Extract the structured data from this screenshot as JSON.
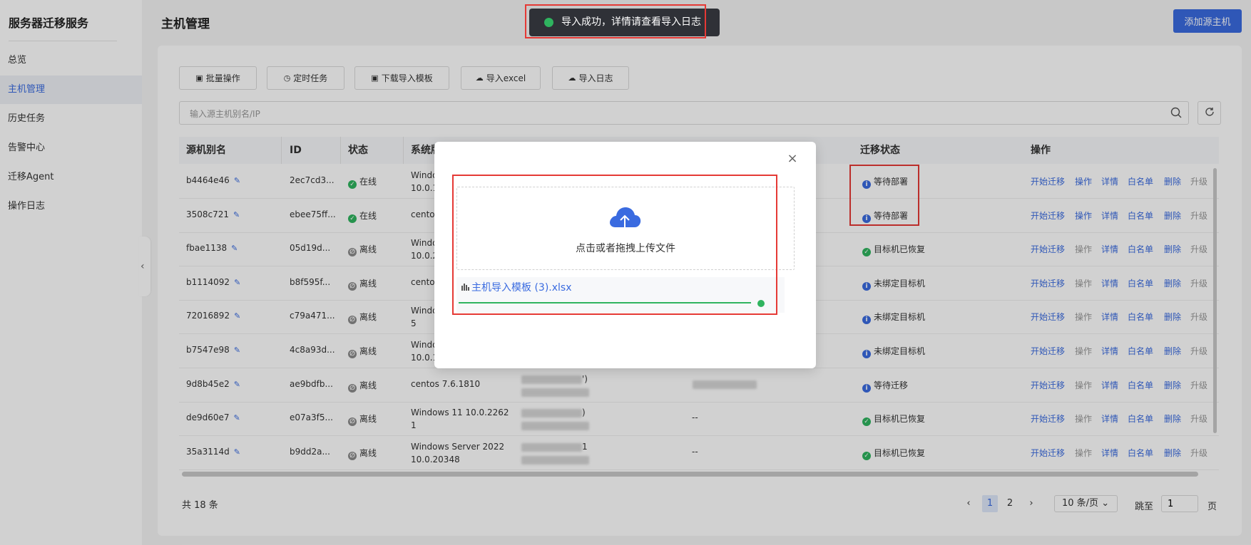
{
  "sidebar": {
    "title": "服务器迁移服务",
    "items": [
      {
        "label": "总览",
        "active": false
      },
      {
        "label": "主机管理",
        "active": true
      },
      {
        "label": "历史任务",
        "active": false
      },
      {
        "label": "告警中心",
        "active": false
      },
      {
        "label": "迁移Agent",
        "active": false
      },
      {
        "label": "操作日志",
        "active": false
      }
    ],
    "collapse_icon": "‹"
  },
  "header": {
    "title": "主机管理",
    "add_source_label": "添加源主机"
  },
  "toolbar": {
    "batch_label": "批量操作",
    "timed_label": "定时任务",
    "download_label": "下载导入模板",
    "import_excel_label": "导入excel",
    "import_log_label": "导入日志"
  },
  "search": {
    "placeholder": "输入源主机别名/IP"
  },
  "table": {
    "headers": {
      "alias": "源机别名",
      "id": "ID",
      "status": "状态",
      "os": "系统版",
      "migration": "迁移状态",
      "ops": "操作"
    },
    "op_labels": [
      "开始迁移",
      "操作",
      "详情",
      "白名单",
      "删除",
      "升级"
    ],
    "rows": [
      {
        "alias": "b4464e46",
        "id": "2ec7cd3...",
        "status": "在线",
        "online": true,
        "os1": "Windo",
        "os2": "10.0.1",
        "mig": "等待部署",
        "mig_ok": false,
        "ip": "",
        "target": ""
      },
      {
        "alias": "3508c721",
        "id": "ebee75ff...",
        "status": "在线",
        "online": true,
        "os1": "cento",
        "os2": "",
        "mig": "等待部署",
        "mig_ok": false,
        "ip": "",
        "target": ""
      },
      {
        "alias": "fbae1138",
        "id": "05d19d...",
        "status": "离线",
        "online": false,
        "os1": "Windo",
        "os2": "10.0.2",
        "mig": "目标机已恢复",
        "mig_ok": true,
        "ip": "",
        "target": ""
      },
      {
        "alias": "b1114092",
        "id": "b8f595f...",
        "status": "离线",
        "online": false,
        "os1": "cento",
        "os2": "",
        "mig": "未绑定目标机",
        "mig_ok": false,
        "ip": "",
        "target": ""
      },
      {
        "alias": "72016892",
        "id": "c79a471...",
        "status": "离线",
        "online": false,
        "os1": "Windo",
        "os2": "5",
        "mig": "未绑定目标机",
        "mig_ok": false,
        "ip": "",
        "target": ""
      },
      {
        "alias": "b7547e98",
        "id": "4c8a93d...",
        "status": "离线",
        "online": false,
        "os1": "Windo",
        "os2": "10.0.1",
        "mig": "未绑定目标机",
        "mig_ok": false,
        "ip": "",
        "target": ""
      },
      {
        "alias": "9d8b45e2",
        "id": "ae9bdfb...",
        "status": "离线",
        "online": false,
        "os1": "centos 7.6.1810",
        "os2": "",
        "mig": "等待迁移",
        "mig_ok": false,
        "ip": "')",
        "target": ""
      },
      {
        "alias": "de9d60e7",
        "id": "e07a3f5...",
        "status": "离线",
        "online": false,
        "os1": "Windows 11 10.0.2262",
        "os2": "1",
        "mig": "目标机已恢复",
        "mig_ok": true,
        "ip": ")",
        "target": "--"
      },
      {
        "alias": "35a3114d",
        "id": "b9dd2a...",
        "status": "离线",
        "online": false,
        "os1": "Windows Server 2022",
        "os2": "10.0.20348",
        "mig": "目标机已恢复",
        "mig_ok": true,
        "ip": "1",
        "target": "--"
      }
    ]
  },
  "footer": {
    "total": "共 18 条",
    "prev_icon": "‹",
    "next_icon": "›",
    "pages": [
      "1",
      "2"
    ],
    "current_page": "1",
    "page_size": "10 条/页",
    "page_size_icon": "⌄",
    "jump_label": "跳至",
    "jump_value": "1",
    "page_suffix": "页"
  },
  "modal": {
    "upload_text": "点击或者拖拽上传文件",
    "file_name": "主机导入模板 (3).xlsx",
    "close_icon": "×"
  },
  "toast": {
    "text": "导入成功，详情请查看导入日志"
  },
  "colors": {
    "accent": "#3a6be0",
    "success": "#2fb45f",
    "annotation": "#e53935"
  }
}
